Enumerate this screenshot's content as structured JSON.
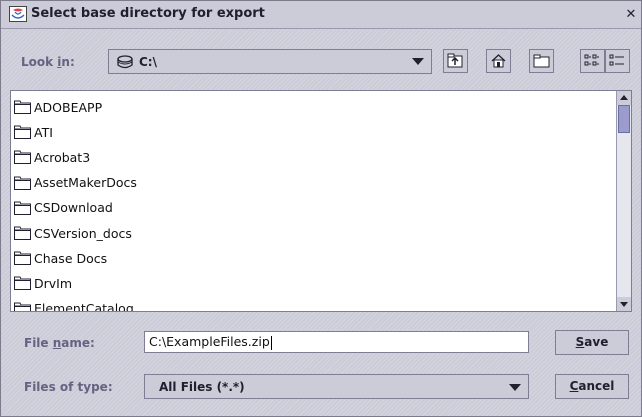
{
  "window": {
    "title": "Select base directory for export",
    "close_glyph": "✕"
  },
  "lookin": {
    "label_pre": "Look ",
    "label_key": "i",
    "label_post": "n:",
    "value": "C:\\",
    "icon": "drive-icon"
  },
  "toolbar": {
    "icons": [
      "up-folder-icon",
      "home-icon",
      "new-folder-icon",
      "list-view-icon",
      "details-view-icon"
    ]
  },
  "files": [
    {
      "name": "ADOBEAPP"
    },
    {
      "name": "ATI"
    },
    {
      "name": "Acrobat3"
    },
    {
      "name": "AssetMakerDocs"
    },
    {
      "name": "CSDownload"
    },
    {
      "name": "CSVersion_docs"
    },
    {
      "name": "Chase Docs"
    },
    {
      "name": "DrvIm"
    },
    {
      "name": "ElementCatalog"
    }
  ],
  "filename": {
    "label_pre": "File ",
    "label_key": "n",
    "label_post": "ame:",
    "value": "C:\\ExampleFiles.zip"
  },
  "filetype": {
    "label": "Files of type:",
    "value": "All Files (*.*)"
  },
  "buttons": {
    "save_key": "S",
    "save_rest": "ave",
    "cancel_key": "C",
    "cancel_rest": "ancel"
  }
}
